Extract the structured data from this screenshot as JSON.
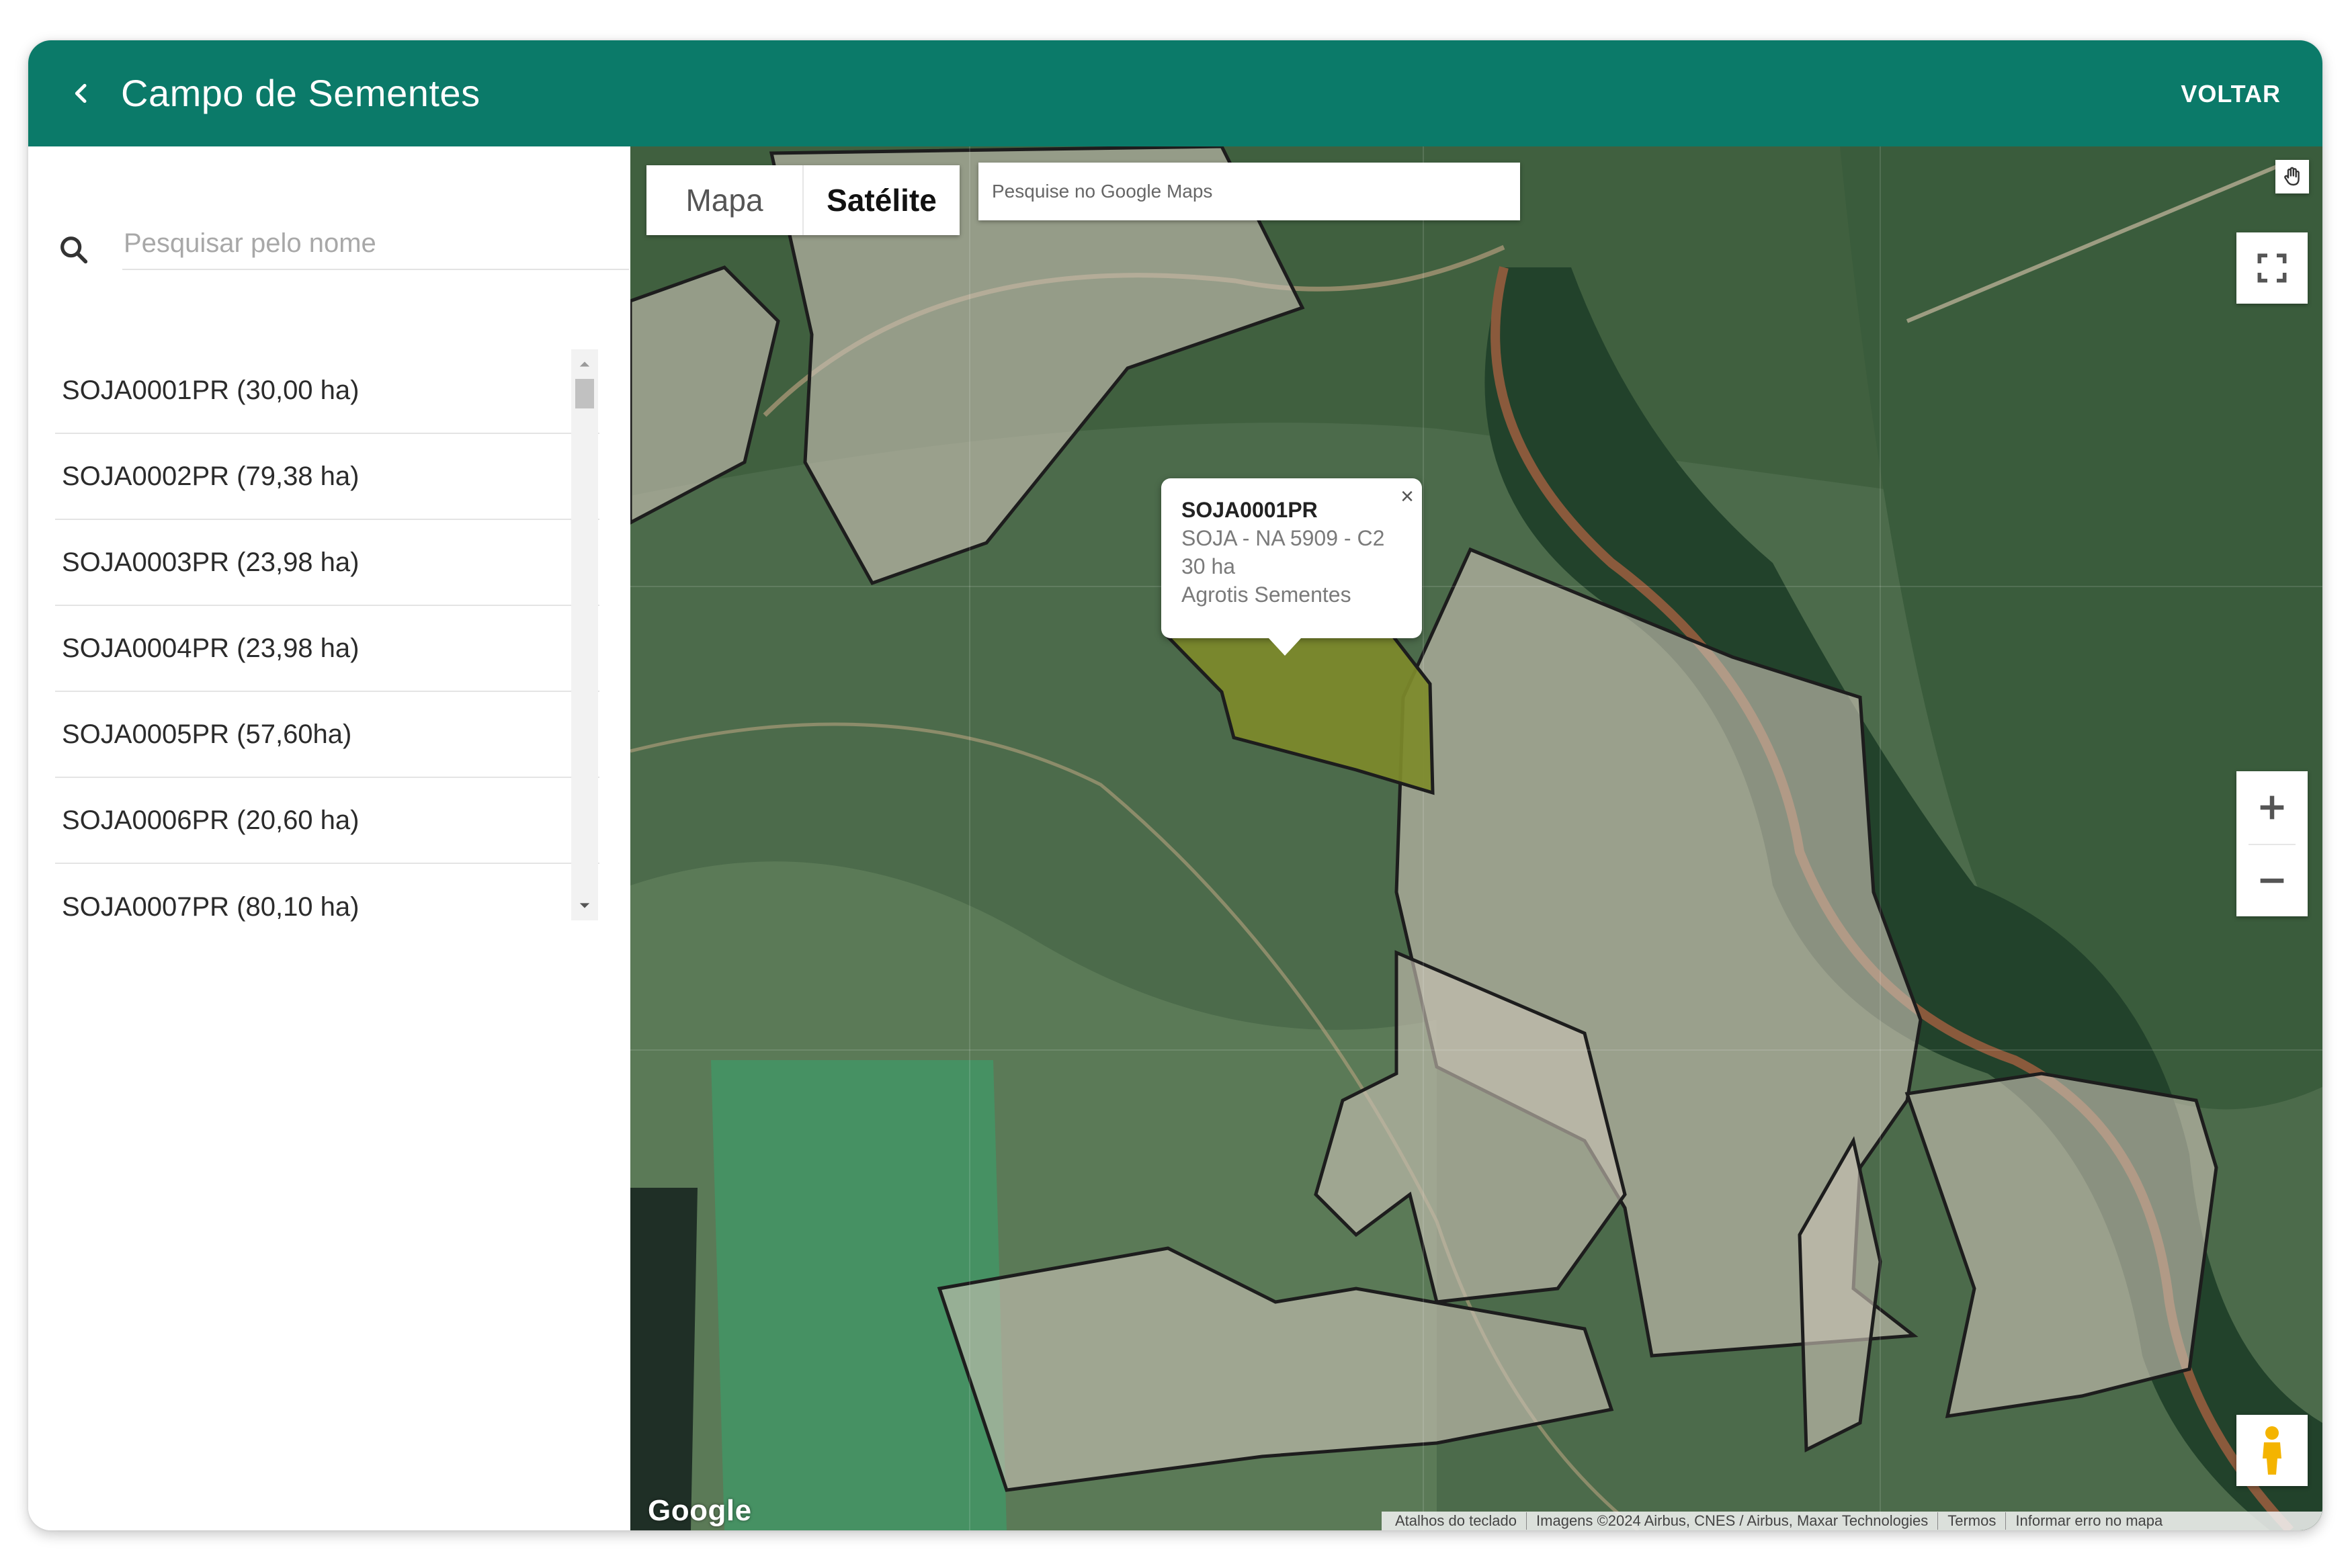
{
  "header": {
    "title": "Campo de Sementes",
    "back_action": "VOLTAR"
  },
  "sidebar": {
    "search_placeholder": "Pesquisar pelo nome",
    "items": [
      {
        "label": "SOJA0001PR (30,00 ha)"
      },
      {
        "label": "SOJA0002PR (79,38 ha)"
      },
      {
        "label": "SOJA0003PR (23,98 ha)"
      },
      {
        "label": "SOJA0004PR (23,98 ha)"
      },
      {
        "label": "SOJA0005PR (57,60ha)"
      },
      {
        "label": "SOJA0006PR (20,60 ha)"
      },
      {
        "label": "SOJA0007PR (80,10 ha)"
      }
    ]
  },
  "map": {
    "type_options": [
      "Mapa",
      "Satélite"
    ],
    "selected_type": "Satélite",
    "search_placeholder": "Pesquise no Google Maps",
    "info_window": {
      "title": "SOJA0001PR",
      "line1": "SOJA - NA 5909 - C2",
      "line2": "30 ha",
      "line3": "Agrotis Sementes"
    },
    "logo": "Google",
    "attribution": [
      "Atalhos do teclado",
      "Imagens ©2024 Airbus, CNES / Airbus, Maxar Technologies",
      "Termos",
      "Informar erro no mapa"
    ],
    "highlight_color": "#7d8a2a",
    "controls": [
      "hand-icon",
      "fullscreen-icon",
      "zoom-in-icon",
      "zoom-out-icon",
      "pegman-icon"
    ]
  },
  "colors": {
    "header": "#0b7a69",
    "field_overlay": "#c9c2b4"
  }
}
